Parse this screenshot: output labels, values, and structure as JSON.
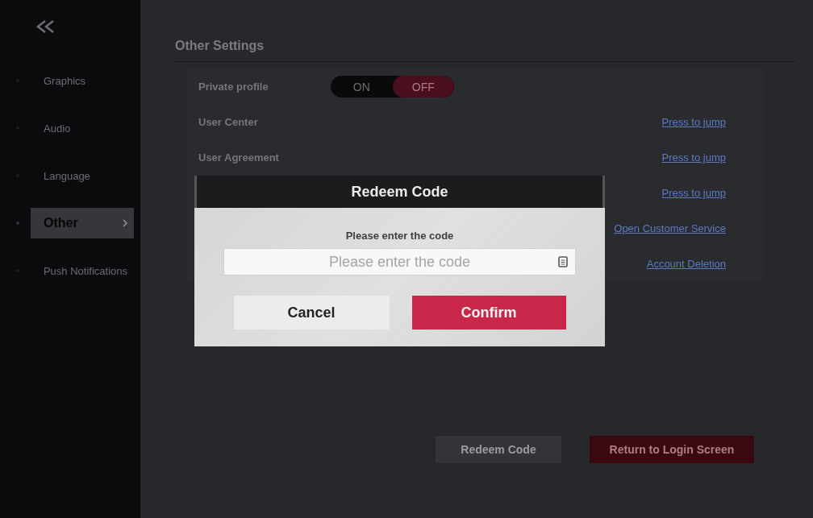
{
  "sidebar": {
    "items": [
      {
        "label": "Graphics",
        "selected": false
      },
      {
        "label": "Audio",
        "selected": false
      },
      {
        "label": "Language",
        "selected": false
      },
      {
        "label": "Other",
        "selected": true
      },
      {
        "label": "Push Notifications",
        "selected": false
      }
    ]
  },
  "section_title": "Other Settings",
  "settings": [
    {
      "kind": "toggle",
      "label": "Private profile",
      "on_label": "ON",
      "off_label": "OFF",
      "on": false
    },
    {
      "kind": "link",
      "label": "User Center",
      "link": "Press to jump"
    },
    {
      "kind": "link",
      "label": "User Agreement",
      "link": "Press to jump"
    },
    {
      "kind": "link",
      "link": "Press to jump"
    },
    {
      "kind": "link",
      "link": "Open Customer Service"
    },
    {
      "kind": "link",
      "link": "Account Deletion"
    }
  ],
  "bottom_buttons": [
    {
      "label": "Redeem Code",
      "kind": "secondary"
    },
    {
      "label": "Return to Login Screen",
      "kind": "primary"
    }
  ],
  "dialog": {
    "title": "Redeem Code",
    "prompt": "Please enter the code",
    "field": {
      "placeholder": "Please enter the code"
    },
    "buttons": [
      {
        "label": "Cancel",
        "kind": "secondary"
      },
      {
        "label": "Confirm",
        "kind": "primary"
      }
    ]
  }
}
